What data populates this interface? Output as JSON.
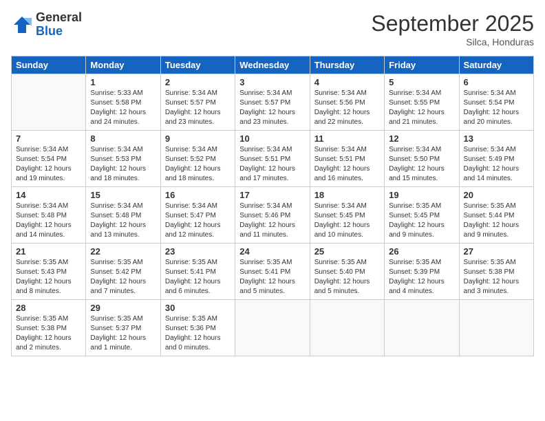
{
  "logo": {
    "general": "General",
    "blue": "Blue"
  },
  "header": {
    "month": "September 2025",
    "location": "Silca, Honduras"
  },
  "days_of_week": [
    "Sunday",
    "Monday",
    "Tuesday",
    "Wednesday",
    "Thursday",
    "Friday",
    "Saturday"
  ],
  "weeks": [
    [
      {
        "day": "",
        "info": ""
      },
      {
        "day": "1",
        "info": "Sunrise: 5:33 AM\nSunset: 5:58 PM\nDaylight: 12 hours and 24 minutes."
      },
      {
        "day": "2",
        "info": "Sunrise: 5:34 AM\nSunset: 5:57 PM\nDaylight: 12 hours and 23 minutes."
      },
      {
        "day": "3",
        "info": "Sunrise: 5:34 AM\nSunset: 5:57 PM\nDaylight: 12 hours and 23 minutes."
      },
      {
        "day": "4",
        "info": "Sunrise: 5:34 AM\nSunset: 5:56 PM\nDaylight: 12 hours and 22 minutes."
      },
      {
        "day": "5",
        "info": "Sunrise: 5:34 AM\nSunset: 5:55 PM\nDaylight: 12 hours and 21 minutes."
      },
      {
        "day": "6",
        "info": "Sunrise: 5:34 AM\nSunset: 5:54 PM\nDaylight: 12 hours and 20 minutes."
      }
    ],
    [
      {
        "day": "7",
        "info": "Sunrise: 5:34 AM\nSunset: 5:54 PM\nDaylight: 12 hours and 19 minutes."
      },
      {
        "day": "8",
        "info": "Sunrise: 5:34 AM\nSunset: 5:53 PM\nDaylight: 12 hours and 18 minutes."
      },
      {
        "day": "9",
        "info": "Sunrise: 5:34 AM\nSunset: 5:52 PM\nDaylight: 12 hours and 18 minutes."
      },
      {
        "day": "10",
        "info": "Sunrise: 5:34 AM\nSunset: 5:51 PM\nDaylight: 12 hours and 17 minutes."
      },
      {
        "day": "11",
        "info": "Sunrise: 5:34 AM\nSunset: 5:51 PM\nDaylight: 12 hours and 16 minutes."
      },
      {
        "day": "12",
        "info": "Sunrise: 5:34 AM\nSunset: 5:50 PM\nDaylight: 12 hours and 15 minutes."
      },
      {
        "day": "13",
        "info": "Sunrise: 5:34 AM\nSunset: 5:49 PM\nDaylight: 12 hours and 14 minutes."
      }
    ],
    [
      {
        "day": "14",
        "info": "Sunrise: 5:34 AM\nSunset: 5:48 PM\nDaylight: 12 hours and 14 minutes."
      },
      {
        "day": "15",
        "info": "Sunrise: 5:34 AM\nSunset: 5:48 PM\nDaylight: 12 hours and 13 minutes."
      },
      {
        "day": "16",
        "info": "Sunrise: 5:34 AM\nSunset: 5:47 PM\nDaylight: 12 hours and 12 minutes."
      },
      {
        "day": "17",
        "info": "Sunrise: 5:34 AM\nSunset: 5:46 PM\nDaylight: 12 hours and 11 minutes."
      },
      {
        "day": "18",
        "info": "Sunrise: 5:34 AM\nSunset: 5:45 PM\nDaylight: 12 hours and 10 minutes."
      },
      {
        "day": "19",
        "info": "Sunrise: 5:35 AM\nSunset: 5:45 PM\nDaylight: 12 hours and 9 minutes."
      },
      {
        "day": "20",
        "info": "Sunrise: 5:35 AM\nSunset: 5:44 PM\nDaylight: 12 hours and 9 minutes."
      }
    ],
    [
      {
        "day": "21",
        "info": "Sunrise: 5:35 AM\nSunset: 5:43 PM\nDaylight: 12 hours and 8 minutes."
      },
      {
        "day": "22",
        "info": "Sunrise: 5:35 AM\nSunset: 5:42 PM\nDaylight: 12 hours and 7 minutes."
      },
      {
        "day": "23",
        "info": "Sunrise: 5:35 AM\nSunset: 5:41 PM\nDaylight: 12 hours and 6 minutes."
      },
      {
        "day": "24",
        "info": "Sunrise: 5:35 AM\nSunset: 5:41 PM\nDaylight: 12 hours and 5 minutes."
      },
      {
        "day": "25",
        "info": "Sunrise: 5:35 AM\nSunset: 5:40 PM\nDaylight: 12 hours and 5 minutes."
      },
      {
        "day": "26",
        "info": "Sunrise: 5:35 AM\nSunset: 5:39 PM\nDaylight: 12 hours and 4 minutes."
      },
      {
        "day": "27",
        "info": "Sunrise: 5:35 AM\nSunset: 5:38 PM\nDaylight: 12 hours and 3 minutes."
      }
    ],
    [
      {
        "day": "28",
        "info": "Sunrise: 5:35 AM\nSunset: 5:38 PM\nDaylight: 12 hours and 2 minutes."
      },
      {
        "day": "29",
        "info": "Sunrise: 5:35 AM\nSunset: 5:37 PM\nDaylight: 12 hours and 1 minute."
      },
      {
        "day": "30",
        "info": "Sunrise: 5:35 AM\nSunset: 5:36 PM\nDaylight: 12 hours and 0 minutes."
      },
      {
        "day": "",
        "info": ""
      },
      {
        "day": "",
        "info": ""
      },
      {
        "day": "",
        "info": ""
      },
      {
        "day": "",
        "info": ""
      }
    ]
  ]
}
